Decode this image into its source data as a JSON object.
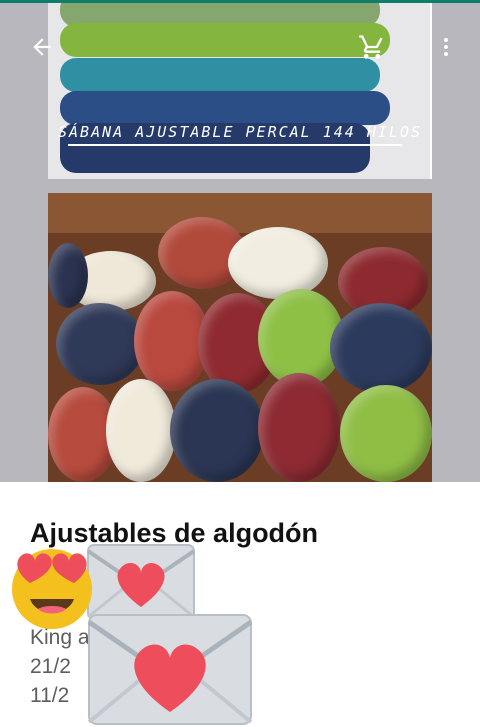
{
  "header": {
    "back_icon": "arrow-left-icon",
    "cart_icon": "shopping-cart-icon",
    "more_icon": "more-vertical-icon"
  },
  "images": {
    "photo1_caption": "SÁBANA AJUSTABLE PERCAL 144 HILOS"
  },
  "product": {
    "title": "Ajustables de algodón",
    "description_lines": [
      "King a",
      "21/2",
      "11/2"
    ]
  },
  "stickers": {
    "emoji": "heart-eyes-emoji-icon",
    "envelope_small": "love-letter-icon",
    "envelope_large": "love-letter-icon"
  },
  "colors": {
    "status_bar": "#0f7d68",
    "title_text": "#121212",
    "desc_text": "#5e5e5e"
  }
}
